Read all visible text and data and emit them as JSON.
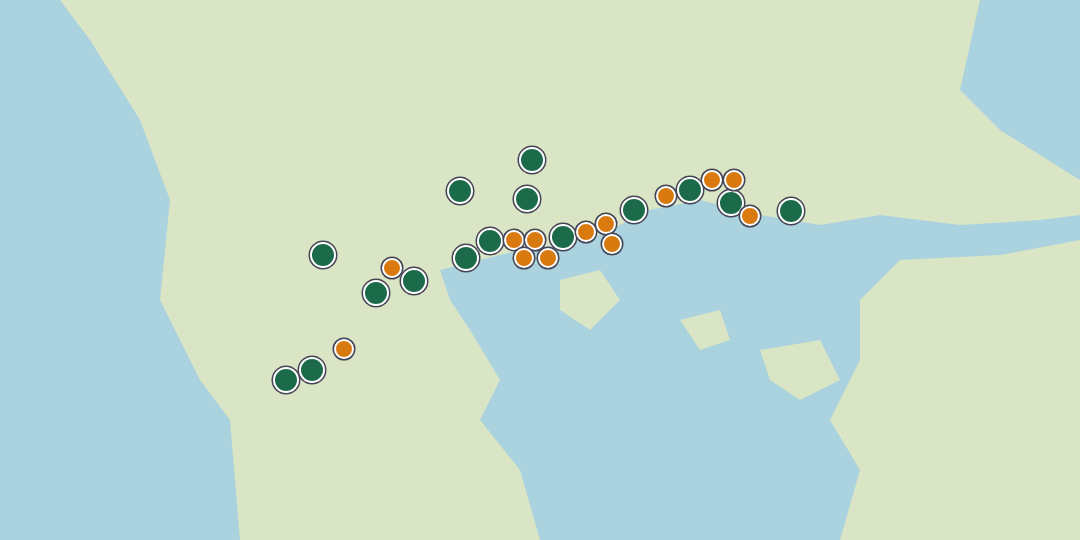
{
  "map": {
    "markers": [
      {
        "color": "#1b6b4a"
      },
      {
        "color": "#1b6b4a"
      },
      {
        "color": "#1b6b4a"
      },
      {
        "color": "#1b6b4a"
      },
      {
        "color": "#1b6b4a"
      },
      {
        "color": "#1b6b4a"
      },
      {
        "color": "#1b6b4a"
      },
      {
        "color": "#1b6b4a"
      },
      {
        "color": "#1b6b4a"
      },
      {
        "color": "#1b6b4a"
      },
      {
        "color": "#1b6b4a"
      },
      {
        "color": "#1b6b4a"
      },
      {
        "color": "#1b6b4a"
      },
      {
        "color": "#1b6b4a"
      },
      {
        "color": "#1b6b4a"
      },
      {
        "color": "#d97a10"
      },
      {
        "color": "#d97a10"
      },
      {
        "color": "#d97a10"
      },
      {
        "color": "#d97a10"
      },
      {
        "color": "#d97a10"
      },
      {
        "color": "#d97a10"
      },
      {
        "color": "#d97a10"
      },
      {
        "color": "#d97a10"
      },
      {
        "color": "#d97a10"
      },
      {
        "color": "#d97a10"
      },
      {
        "color": "#d97a10"
      },
      {
        "color": "#d97a10"
      },
      {
        "color": "#d97a10"
      }
    ]
  }
}
